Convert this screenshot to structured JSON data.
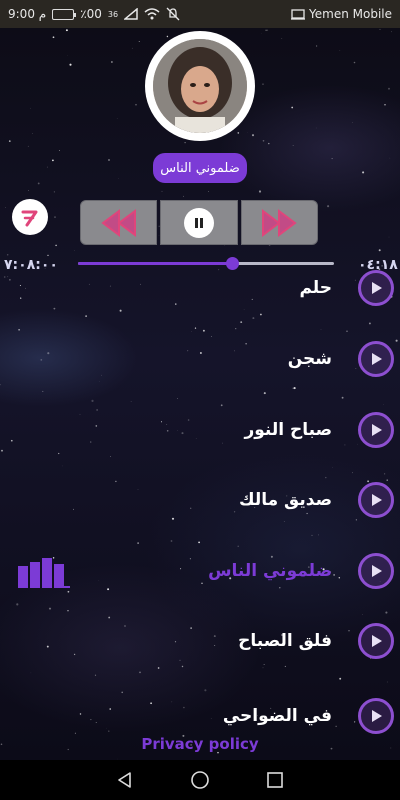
{
  "status_bar": {
    "carrier": "Yemen Mobile",
    "time": "9:00 م",
    "battery_text": "٪00",
    "battery_level": 0.0,
    "network": "36",
    "icons": [
      "notifications-muted-icon",
      "wifi-icon",
      "signal-icon",
      "battery-icon",
      "cast-icon"
    ]
  },
  "player": {
    "now_playing_title": "ضلموني الناس",
    "elapsed": "٠٤:١٨",
    "duration": "٧:٠٨:٠٠",
    "progress": 0.6,
    "controls": [
      "previous-icon",
      "pause-icon",
      "next-icon"
    ],
    "share_icon": "share-icon"
  },
  "songs": [
    {
      "title": "حلم",
      "active": false
    },
    {
      "title": "شجن",
      "active": false
    },
    {
      "title": "صباح النور",
      "active": false
    },
    {
      "title": "صديق مالك",
      "active": false
    },
    {
      "title": "ضلموني الناس",
      "active": true
    },
    {
      "title": "فلق الصباح",
      "active": false
    },
    {
      "title": "في الضواحي",
      "active": false
    }
  ],
  "footer": {
    "privacy_link": "Privacy policy"
  },
  "nav": {
    "icons": [
      "back-icon",
      "home-icon",
      "recents-icon"
    ]
  },
  "colors": {
    "accent": "#7c3bd6",
    "status_bar": "#2a2722",
    "control_bg": "#8a8a8e",
    "arrow_pink": "#e0457b"
  }
}
